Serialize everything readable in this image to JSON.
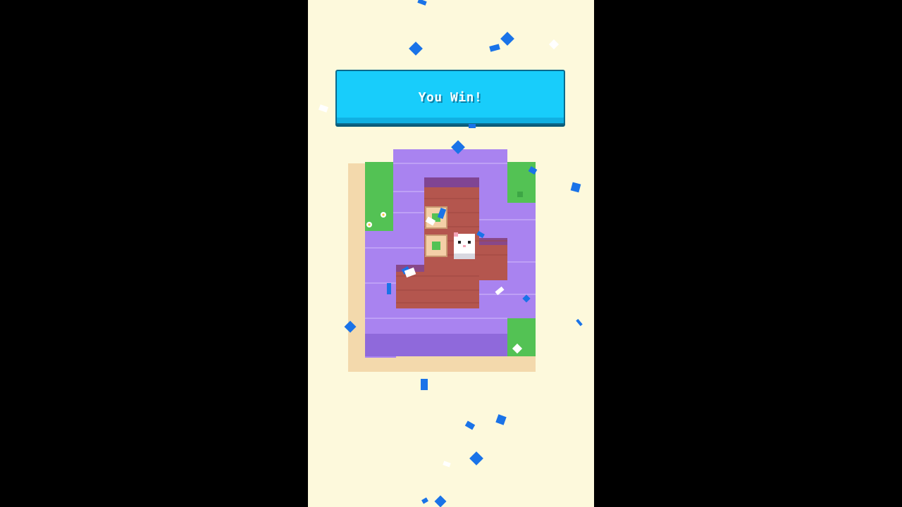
{
  "banner": {
    "title": "You Win!"
  },
  "colors": {
    "background": "#fdf9dc",
    "banner": "#18cdfb",
    "wall": "#a983f0",
    "floor": "#b4564e",
    "grass": "#53c254",
    "confetti": "#1a73e8"
  },
  "icons": {
    "player": "cat-icon",
    "crate": "crate-icon",
    "goal": "goal-marker-icon",
    "flower": "flower-icon"
  }
}
